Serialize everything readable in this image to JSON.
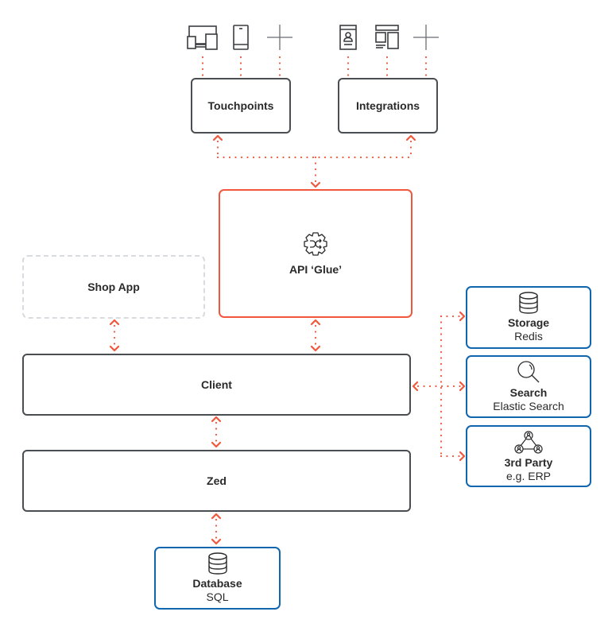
{
  "diagram": {
    "accent_color": "#f0573c",
    "node_border_color": "#4a4d52",
    "service_border_color": "#1166b0",
    "optional_border_color": "#d8dbdf",
    "nodes": {
      "touchpoints": {
        "title": "Touchpoints"
      },
      "integrations": {
        "title": "Integrations"
      },
      "api_glue": {
        "title": "API ‘Glue’",
        "icon": "gear-shuffle-icon"
      },
      "shop_app": {
        "title": "Shop App"
      },
      "client": {
        "title": "Client"
      },
      "zed": {
        "title": "Zed"
      },
      "storage": {
        "title": "Storage",
        "subtitle": "Redis",
        "icon": "database-icon"
      },
      "search": {
        "title": "Search",
        "subtitle": "Elastic Search",
        "icon": "magnifier-icon"
      },
      "third_party": {
        "title": "3rd Party",
        "subtitle": "e.g. ERP",
        "icon": "network-people-icon"
      },
      "database": {
        "title": "Database",
        "subtitle": "SQL",
        "icon": "database-icon"
      }
    },
    "touchpoint_icons": [
      "multi-device-icon",
      "smartphone-icon",
      "plus-icon"
    ],
    "integration_icons": [
      "profile-card-icon",
      "layout-icon",
      "plus-icon"
    ],
    "connections": [
      {
        "from": "touchpoints",
        "to": "api_glue"
      },
      {
        "from": "integrations",
        "to": "api_glue"
      },
      {
        "from": "api_glue",
        "to": "client"
      },
      {
        "from": "shop_app",
        "to": "client"
      },
      {
        "from": "client",
        "to": "zed"
      },
      {
        "from": "zed",
        "to": "database"
      },
      {
        "from": "client",
        "to": "storage"
      },
      {
        "from": "client",
        "to": "search"
      },
      {
        "from": "client",
        "to": "third_party"
      }
    ]
  }
}
